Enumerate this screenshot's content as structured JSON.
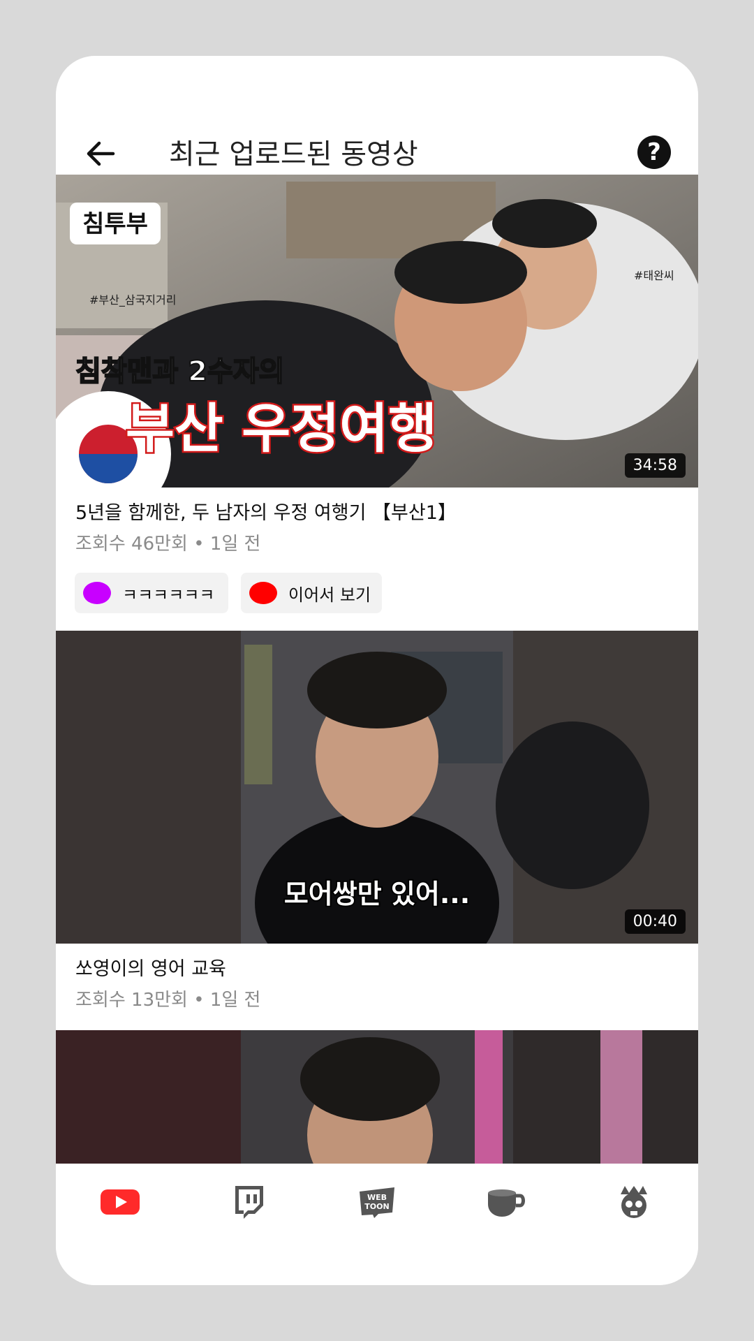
{
  "header": {
    "title": "최근 업로드된 동영상",
    "back_icon": "arrow-left-icon",
    "help_icon": "question-circle-icon",
    "help_glyph": "?"
  },
  "videos": [
    {
      "thumbnail": {
        "logo_text": "침투부",
        "tag_left": "#부산_삼국지거리",
        "tag_right": "#태완씨",
        "line1": "침착맨과 2수자의",
        "line2": "부산 우정여행"
      },
      "duration": "34:58",
      "title": "5년을 함께한, 두 남자의 우정 여행기 【부산1】",
      "meta": "조회수 46만회 • 1일 전",
      "chips": [
        {
          "label": "ㅋㅋㅋㅋㅋㅋ",
          "color": "#c800ff"
        },
        {
          "label": "이어서 보기",
          "color": "#ff0000"
        }
      ]
    },
    {
      "thumbnail": {
        "caption": "모어쌍만 있어..."
      },
      "duration": "00:40",
      "title": "쏘영이의 영어 교육",
      "meta": "조회수 13만회 • 1일 전"
    },
    {
      "thumbnail": {}
    }
  ],
  "bottom_nav": [
    {
      "icon": "youtube-icon",
      "color": "#ff0000"
    },
    {
      "icon": "twitch-icon",
      "color": "#555555"
    },
    {
      "icon": "webtoon-icon",
      "color": "#555555",
      "text": "WEB TOON"
    },
    {
      "icon": "coffee-cup-icon",
      "color": "#555555"
    },
    {
      "icon": "mascot-icon",
      "color": "#555555"
    }
  ]
}
